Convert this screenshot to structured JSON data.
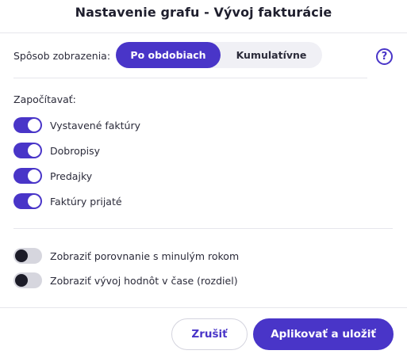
{
  "dialog": {
    "title": "Nastavenie grafu - Vývoj fakturácie"
  },
  "display_mode": {
    "label": "Spôsob zobrazenia:",
    "options": [
      "Po obdobiach",
      "Kumulatívne"
    ],
    "selected": "Po obdobiach"
  },
  "help": {
    "icon": "question-circle-icon",
    "glyph": "?"
  },
  "count_section": {
    "label": "Započítavať:",
    "items": [
      {
        "label": "Vystavené faktúry",
        "checked": true
      },
      {
        "label": "Dobropisy",
        "checked": true
      },
      {
        "label": "Predajky",
        "checked": true
      },
      {
        "label": "Faktúry prijaté",
        "checked": true
      }
    ]
  },
  "extra_options": {
    "items": [
      {
        "label": "Zobraziť porovnanie s minulým rokom",
        "checked": false
      },
      {
        "label": "Zobraziť vývoj hodnôt v čase (rozdiel)",
        "checked": false
      }
    ]
  },
  "footer": {
    "cancel_label": "Zrušiť",
    "apply_label": "Aplikovať a uložiť"
  },
  "colors": {
    "accent": "#4935c8",
    "toggle_off": "#d6d6de"
  }
}
